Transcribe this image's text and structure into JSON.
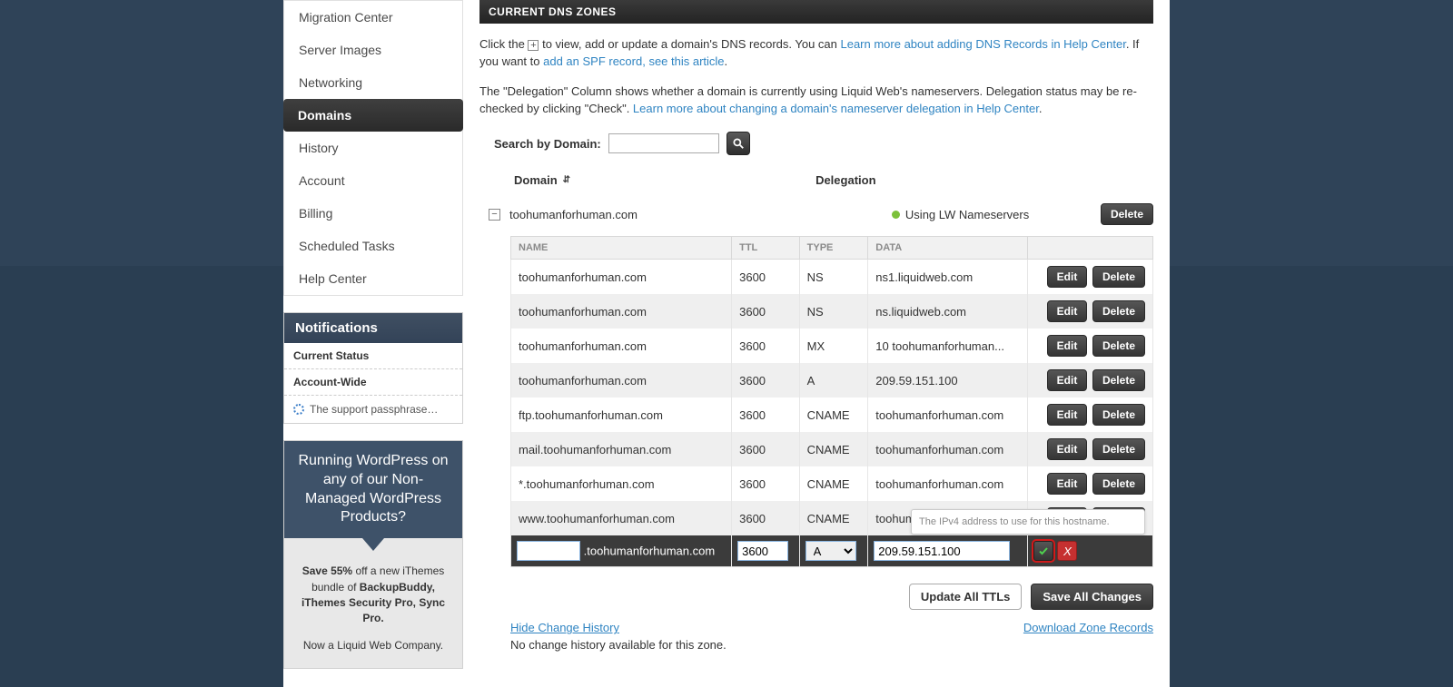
{
  "nav": {
    "items": [
      {
        "label": "Migration Center",
        "active": false
      },
      {
        "label": "Server Images",
        "active": false
      },
      {
        "label": "Networking",
        "active": false
      },
      {
        "label": "Domains",
        "active": true
      },
      {
        "label": "History",
        "active": false
      },
      {
        "label": "Account",
        "active": false
      },
      {
        "label": "Billing",
        "active": false
      },
      {
        "label": "Scheduled Tasks",
        "active": false
      },
      {
        "label": "Help Center",
        "active": false
      }
    ]
  },
  "notifications": {
    "header": "Notifications",
    "current_status": "Current Status",
    "account_wide": "Account-Wide",
    "item": "The support passphrase…"
  },
  "ad": {
    "top": "Running WordPress on any of our Non-Managed WordPress Products?",
    "save_bold": "Save 55%",
    "save_rest": " off a new iThemes bundle of ",
    "bundle_bold": "BackupBuddy, iThemes Security Pro, Sync Pro.",
    "now_a": "Now a Liquid Web Company."
  },
  "panel": {
    "title": "CURRENT DNS ZONES",
    "intro1_a": "Click the ",
    "intro1_b": " to view, add or update a domain's DNS records. You can ",
    "intro1_link": "Learn more about adding DNS Records in Help Center",
    "intro1_c": ". If you want to ",
    "spf_link": "add an SPF record, see this article",
    "intro1_d": ".",
    "intro2_a": "The \"Delegation\" Column shows whether a domain is currently using Liquid Web's nameservers. Delegation status may be re-checked by clicking \"Check\". ",
    "intro2_link": "Learn more about changing a domain's nameserver delegation in Help Center",
    "intro2_b": "."
  },
  "search": {
    "label": "Search by Domain:"
  },
  "columns": {
    "domain": "Domain",
    "delegation": "Delegation"
  },
  "zone": {
    "name": "toohumanforhuman.com",
    "status": "Using LW Nameservers",
    "delete_label": "Delete"
  },
  "table": {
    "headers": {
      "name": "NAME",
      "ttl": "TTL",
      "type": "TYPE",
      "data": "DATA"
    },
    "rows": [
      {
        "name": "toohumanforhuman.com",
        "ttl": "3600",
        "type": "NS",
        "data": "ns1.liquidweb.com"
      },
      {
        "name": "toohumanforhuman.com",
        "ttl": "3600",
        "type": "NS",
        "data": "ns.liquidweb.com"
      },
      {
        "name": "toohumanforhuman.com",
        "ttl": "3600",
        "type": "MX",
        "data": "10 toohumanforhuman..."
      },
      {
        "name": "toohumanforhuman.com",
        "ttl": "3600",
        "type": "A",
        "data": "209.59.151.100"
      },
      {
        "name": "ftp.toohumanforhuman.com",
        "ttl": "3600",
        "type": "CNAME",
        "data": "toohumanforhuman.com"
      },
      {
        "name": "mail.toohumanforhuman.com",
        "ttl": "3600",
        "type": "CNAME",
        "data": "toohumanforhuman.com"
      },
      {
        "name": "*.toohumanforhuman.com",
        "ttl": "3600",
        "type": "CNAME",
        "data": "toohumanforhuman.com"
      },
      {
        "name": "www.toohumanforhuman.com",
        "ttl": "3600",
        "type": "CNAME",
        "data": "toohumanforhuman.com"
      }
    ],
    "edit_label": "Edit",
    "delete_label": "Delete"
  },
  "new_record": {
    "suffix": ".toohumanforhuman.com",
    "ttl": "3600",
    "type": "A",
    "data": "209.59.151.100"
  },
  "tooltip": "The IPv4 address to use for this hostname.",
  "footer": {
    "update_ttls": "Update All TTLs",
    "save_all": "Save All Changes",
    "hide_history": "Hide Change History",
    "download": "Download Zone Records",
    "no_history": "No change history available for this zone."
  }
}
